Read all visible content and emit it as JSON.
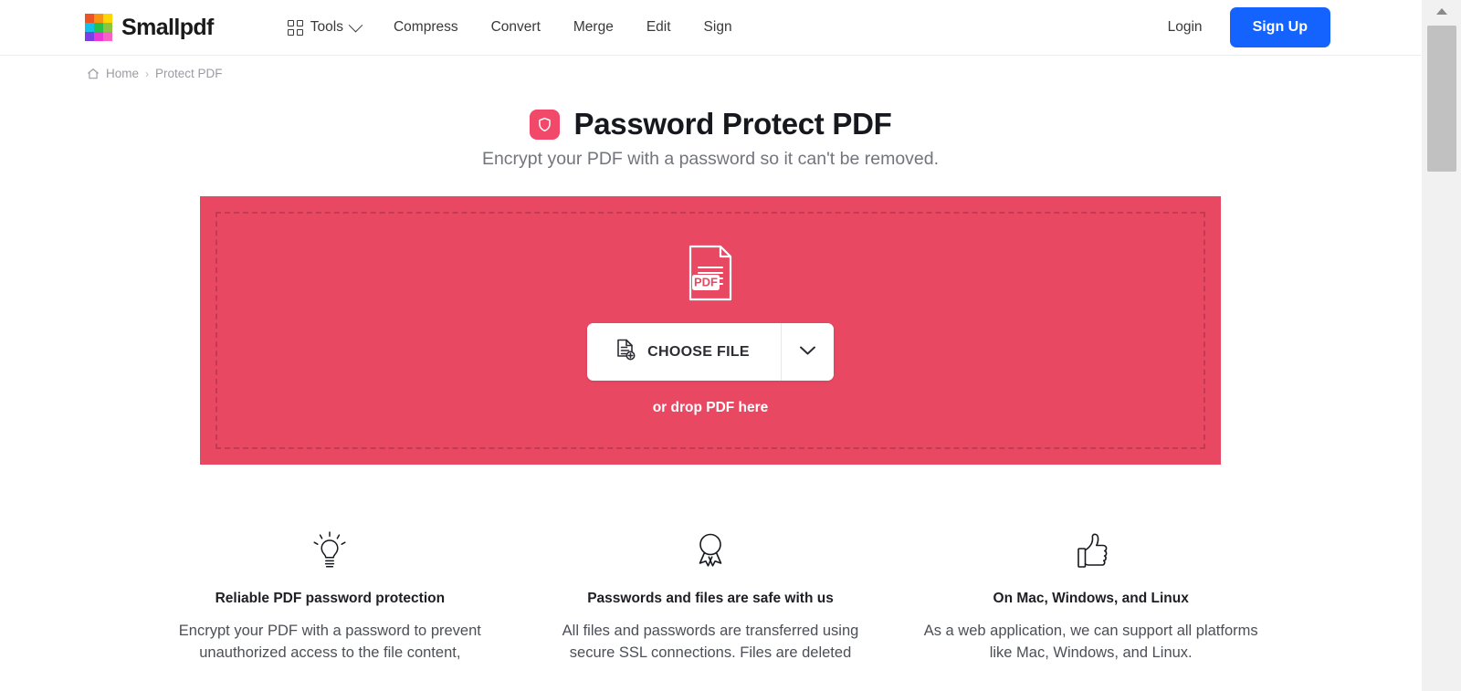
{
  "header": {
    "brand_name": "Smallpdf",
    "logo_icon": "smallpdf-color-grid-logo",
    "logo_colors": [
      "#f05322",
      "#f79410",
      "#fcd703",
      "#13c0e8",
      "#27c04a",
      "#8cc63e",
      "#7a3fe4",
      "#e838d6",
      "#f663c7"
    ],
    "nav_items": [
      {
        "label": "Tools",
        "icon": "grid-icon",
        "has_caret": true
      },
      {
        "label": "Compress",
        "icon": null,
        "has_caret": false
      },
      {
        "label": "Convert",
        "icon": null,
        "has_caret": false
      },
      {
        "label": "Merge",
        "icon": null,
        "has_caret": false
      },
      {
        "label": "Edit",
        "icon": null,
        "has_caret": false
      },
      {
        "label": "Sign",
        "icon": null,
        "has_caret": false
      }
    ],
    "login_label": "Login",
    "signup_label": "Sign Up",
    "signup_color": "#1463ff"
  },
  "breadcrumb": {
    "home_icon": "home-icon",
    "home_label": "Home",
    "separator": "›",
    "current_label": "Protect PDF"
  },
  "hero": {
    "badge_icon": "shield-icon",
    "badge_color": "#f2496b",
    "title": "Password Protect PDF",
    "subtitle": "Encrypt your PDF with a password so it can't be removed."
  },
  "dropzone": {
    "background_color": "#e94862",
    "border_color": "#c23a55",
    "document_icon": "pdf-document-icon",
    "document_icon_label": "PDF",
    "choose_file_icon": "document-add-icon",
    "choose_file_label": "CHOOSE FILE",
    "caret_icon": "chevron-down-icon",
    "drop_hint": "or drop PDF here"
  },
  "features": [
    {
      "icon": "lightbulb-icon",
      "title": "Reliable PDF password protection",
      "text": "Encrypt your PDF with a password to prevent unauthorized access to the file content,"
    },
    {
      "icon": "award-ribbon-icon",
      "title": "Passwords and files are safe with us",
      "text": "All files and passwords are transferred using secure SSL connections. Files are deleted"
    },
    {
      "icon": "thumbs-up-icon",
      "title": "On Mac, Windows, and Linux",
      "text": "As a web application, we can support all platforms like Mac, Windows, and Linux."
    }
  ],
  "scrollbar": {
    "up_arrow_icon": "scroll-up-arrow-icon",
    "thumb": "scrollbar-thumb"
  }
}
